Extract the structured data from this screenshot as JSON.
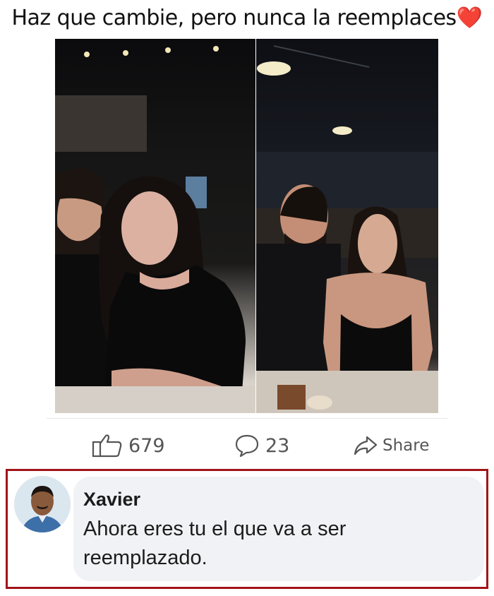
{
  "caption": {
    "text": "Haz que cambie, pero nunca la reemplaces",
    "emoji": "❤️"
  },
  "post": {
    "likes": "679",
    "comments": "23",
    "share_label": "Share",
    "icons": [
      "thumbs-up-icon",
      "comment-bubble-icon",
      "share-arrow-icon"
    ]
  },
  "comment": {
    "author": "Xavier",
    "text": "Ahora eres tu el que va a ser reemplazado."
  },
  "colors": {
    "highlight_border": "#a21418",
    "bubble_bg": "#f0f2f5",
    "heart": "#e0241b"
  }
}
